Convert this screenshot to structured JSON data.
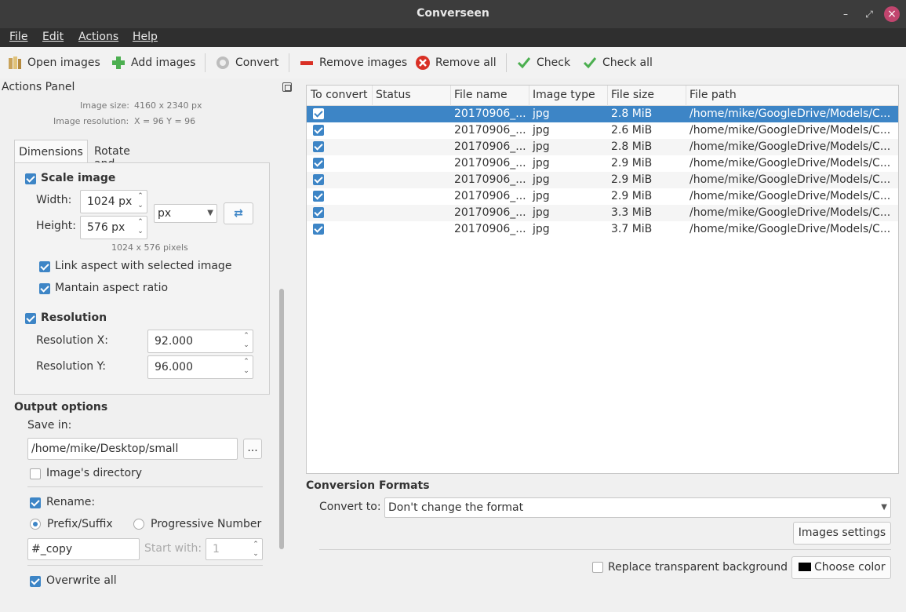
{
  "window": {
    "title": "Converseen"
  },
  "menu": {
    "items": [
      "File",
      "Edit",
      "Actions",
      "Help"
    ]
  },
  "toolbar": {
    "open_images": "Open images",
    "add_images": "Add images",
    "convert": "Convert",
    "remove_images": "Remove images",
    "remove_all": "Remove all",
    "check": "Check",
    "check_all": "Check all"
  },
  "actions_panel": {
    "title": "Actions Panel",
    "image_size_label": "Image size:",
    "image_size_value": "4160 x 2340 px",
    "image_resolution_label": "Image resolution:",
    "image_resolution_value": "X = 96 Y = 96",
    "tabs": [
      "Dimensions",
      "Rotate and flip"
    ],
    "scale_image": "Scale image",
    "width_label": "Width:",
    "width_value": "1024 px",
    "height_label": "Height:",
    "height_value": "576 px",
    "unit": "px",
    "pixels_note": "1024 x 576 pixels",
    "link_aspect": "Link aspect with selected image",
    "maintain_aspect": "Mantain aspect ratio",
    "resolution": "Resolution",
    "res_x_label": "Resolution X:",
    "res_x_value": "92.000",
    "res_y_label": "Resolution Y:",
    "res_y_value": "96.000"
  },
  "output": {
    "title": "Output options",
    "save_in_label": "Save in:",
    "save_in_value": "/home/mike/Desktop/small",
    "browse": "...",
    "image_directory": "Image's directory",
    "rename": "Rename:",
    "prefix_suffix": "Prefix/Suffix",
    "progressive_number": "Progressive Number",
    "rename_value": "#_copy",
    "start_with_label": "Start with:",
    "start_with_value": "1",
    "overwrite_all": "Overwrite all"
  },
  "table": {
    "columns": [
      "To convert",
      "Status",
      "File name",
      "Image type",
      "File size",
      "File path"
    ],
    "rows": [
      {
        "name": "20170906_...",
        "type": "jpg",
        "size": "2.8 MiB",
        "path": "/home/mike/GoogleDrive/Models/C..."
      },
      {
        "name": "20170906_...",
        "type": "jpg",
        "size": "2.6 MiB",
        "path": "/home/mike/GoogleDrive/Models/C..."
      },
      {
        "name": "20170906_...",
        "type": "jpg",
        "size": "2.8 MiB",
        "path": "/home/mike/GoogleDrive/Models/C..."
      },
      {
        "name": "20170906_...",
        "type": "jpg",
        "size": "2.9 MiB",
        "path": "/home/mike/GoogleDrive/Models/C..."
      },
      {
        "name": "20170906_...",
        "type": "jpg",
        "size": "2.9 MiB",
        "path": "/home/mike/GoogleDrive/Models/C..."
      },
      {
        "name": "20170906_...",
        "type": "jpg",
        "size": "2.9 MiB",
        "path": "/home/mike/GoogleDrive/Models/C..."
      },
      {
        "name": "20170906_...",
        "type": "jpg",
        "size": "3.3 MiB",
        "path": "/home/mike/GoogleDrive/Models/C..."
      },
      {
        "name": "20170906_...",
        "type": "jpg",
        "size": "3.7 MiB",
        "path": "/home/mike/GoogleDrive/Models/C..."
      }
    ]
  },
  "conversion": {
    "title": "Conversion Formats",
    "convert_to_label": "Convert to:",
    "convert_to_value": "Don't change the format",
    "images_settings": "Images settings",
    "replace_transparent": "Replace transparent background",
    "choose_color": "Choose color"
  },
  "colors": {
    "accent": "#3d85c6",
    "titlebar": "#3c3c3c",
    "menubar": "#2f2f2f"
  }
}
